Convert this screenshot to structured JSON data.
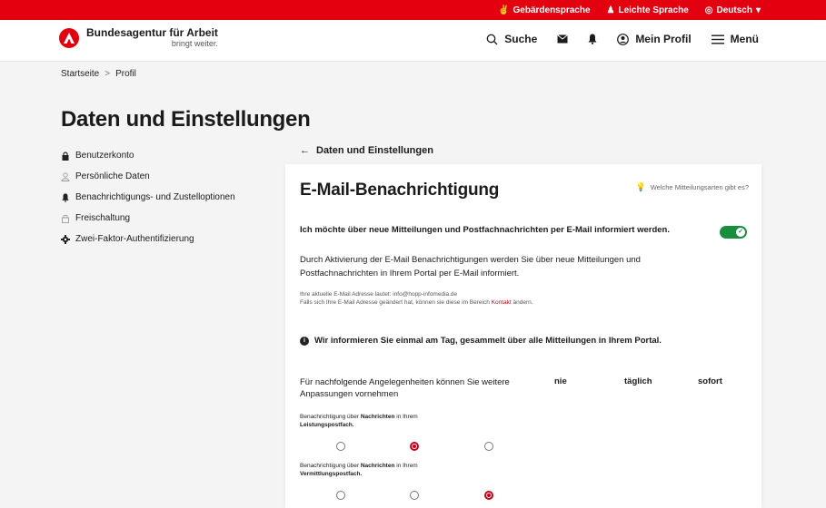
{
  "topbar": {
    "items": [
      {
        "icon": "sign-language-icon",
        "glyph": "✌",
        "label": "Gebärdensprache"
      },
      {
        "icon": "easy-language-icon",
        "glyph": "♟",
        "label": "Leichte Sprache"
      },
      {
        "icon": "globe-icon",
        "glyph": "◎",
        "label": "Deutsch",
        "caret": "▾"
      }
    ]
  },
  "header": {
    "logo_title": "Bundesagentur für Arbeit",
    "logo_subtitle": "bringt weiter.",
    "search_label": "Suche",
    "profile_label": "Mein Profil",
    "menu_label": "Menü"
  },
  "breadcrumb": {
    "home": "Startseite",
    "separator": ">",
    "current": "Profil"
  },
  "page_title": "Daten und Einstellungen",
  "sidebar": {
    "items": [
      {
        "label": "Benutzerkonto",
        "icon": "lock-icon",
        "glyph": "🔒"
      },
      {
        "label": "Persönliche Daten",
        "icon": "person-icon",
        "glyph": "👤"
      },
      {
        "label": "Benachrichtigungs- und Zustelloptionen",
        "icon": "bell-icon",
        "glyph": "🔔"
      },
      {
        "label": "Freischaltung",
        "icon": "unlock-icon",
        "glyph": "🔓"
      },
      {
        "label": "Zwei-Faktor-Authentifizierung",
        "icon": "gear-icon",
        "glyph": "⚙"
      }
    ]
  },
  "back_link": {
    "arrow": "←",
    "label": "Daten und Einstellungen"
  },
  "card": {
    "title": "E-Mail-Benachrichtigung",
    "hint": "Welche Mitteilungsarten gibt es?",
    "optin_text": "Ich möchte über neue Mitteilungen und Postfachnachrichten per E-Mail informiert werden.",
    "optin_enabled": true,
    "description": "Durch Aktivierung der E-Mail Benachrichtigungen werden Sie über neue Mitteilungen und Postfachnachrichten in Ihrem Portal per E-Mail informiert.",
    "info_line1": "Ihre aktuelle E-Mail Adresse lautet: info@hopp-infomedia.de",
    "info_line2_pre": "Falls sich Ihre E-Mail Adresse geändert hat, können sie diese im Bereich ",
    "info_link": "Kontakt",
    "info_line2_post": " ändern.",
    "notice": "Wir informieren Sie einmal am Tag, gesammelt über alle Mitteilungen in Ihrem Portal.",
    "matrix_intro": "Für nachfolgende Angelegenheiten können Sie weitere Anpassungen vornehmen",
    "columns": [
      "nie",
      "täglich",
      "sofort"
    ],
    "rows": [
      {
        "pre": "Benachrichtigung über ",
        "bold": "Nachrichten",
        "mid": " in Ihrem",
        "bold2": "Leistungspostfach.",
        "selected": "täglich"
      },
      {
        "pre": "Benachrichtigung über ",
        "bold": "Nachrichten",
        "mid": " in Ihrem",
        "bold2": "Vermittlungspostfach.",
        "selected": "sofort"
      }
    ]
  },
  "colors": {
    "brand_red": "#e3000f",
    "toggle_green": "#1a8e3f",
    "radio_red": "#c8001b"
  }
}
